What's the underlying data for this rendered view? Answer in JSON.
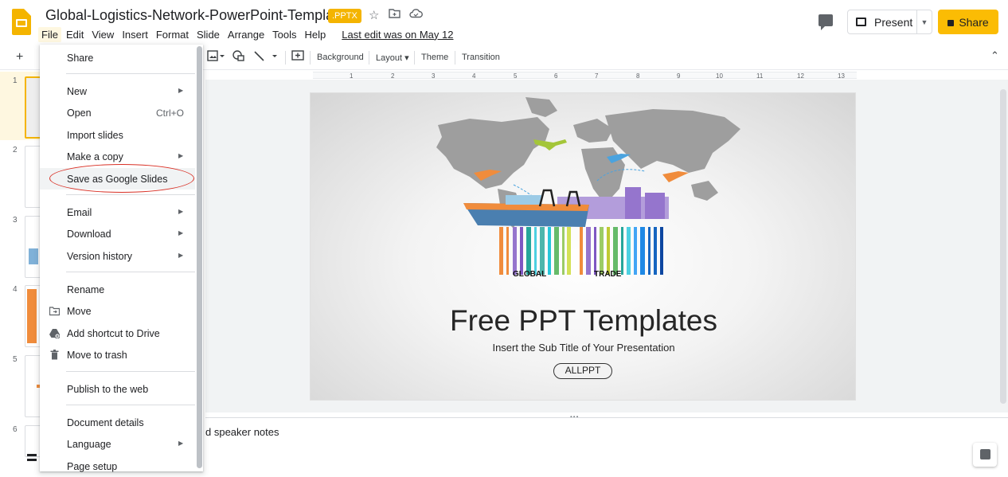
{
  "doc": {
    "title": "Global-Logistics-Network-PowerPoint-Templates",
    "badge": ".PPTX",
    "last_edit": "Last edit was on May 12"
  },
  "menubar": [
    "File",
    "Edit",
    "View",
    "Insert",
    "Format",
    "Slide",
    "Arrange",
    "Tools",
    "Help"
  ],
  "header": {
    "present_label": "Present",
    "share_label": "Share"
  },
  "toolbar": {
    "background": "Background",
    "layout": "Layout",
    "theme": "Theme",
    "transition": "Transition"
  },
  "ruler_marks": [
    "1",
    "2",
    "3",
    "4",
    "5",
    "6",
    "7",
    "8",
    "9",
    "10",
    "11",
    "12",
    "13"
  ],
  "slide_numbers": [
    "1",
    "2",
    "3",
    "4",
    "5",
    "6"
  ],
  "file_menu": {
    "share": "Share",
    "new": "New",
    "open": "Open",
    "open_shortcut": "Ctrl+O",
    "import_slides": "Import slides",
    "make_copy": "Make a copy",
    "save_as_slides": "Save as Google Slides",
    "email": "Email",
    "download": "Download",
    "version_history": "Version history",
    "rename": "Rename",
    "move": "Move",
    "add_shortcut": "Add shortcut to Drive",
    "move_trash": "Move to trash",
    "publish": "Publish to the web",
    "document_details": "Document details",
    "language": "Language",
    "page_setup": "Page setup"
  },
  "slide": {
    "label_global": "GLOBAL",
    "label_trade": "TRADE",
    "title": "Free PPT Templates",
    "subtitle": "Insert the Sub Title of Your Presentation",
    "logo": "ALLPPT"
  },
  "speaker_notes": "d speaker notes",
  "colors": {
    "accent_yellow": "#fbbc04",
    "highlight_circle": "#d93025"
  }
}
